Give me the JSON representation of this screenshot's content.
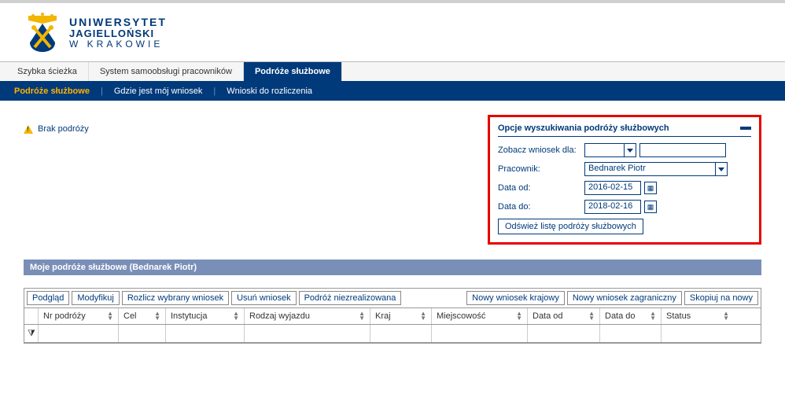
{
  "org": {
    "line1": "UNIWERSYTET",
    "line2": "JAGIELLOŃSKI",
    "line3": "W KRAKOWIE"
  },
  "nav1": {
    "tabs": [
      {
        "label": "Szybka ścieżka",
        "active": false
      },
      {
        "label": "System samoobsługi pracowników",
        "active": false
      },
      {
        "label": "Podróże służbowe",
        "active": true
      }
    ]
  },
  "nav2": {
    "items": [
      {
        "label": "Podróże służbowe",
        "active": true
      },
      {
        "label": "Gdzie jest mój wniosek",
        "active": false
      },
      {
        "label": "Wnioski do rozliczenia",
        "active": false
      }
    ]
  },
  "warning": "Brak podróży",
  "search": {
    "title": "Opcje wyszukiwania podróży służbowych",
    "zobacz_label": "Zobacz wniosek dla:",
    "zobacz_value": "",
    "pracownik_label": "Pracownik:",
    "pracownik_value": "Bednarek Piotr",
    "data_od_label": "Data od:",
    "data_od_value": "2016-02-15",
    "data_do_label": "Data do:",
    "data_do_value": "2018-02-16",
    "refresh": "Odśwież listę podróży służbowych"
  },
  "section_title": "Moje podróże służbowe (Bednarek Piotr)",
  "toolbar": {
    "left": [
      "Podgląd",
      "Modyfikuj",
      "Rozlicz wybrany wniosek",
      "Usuń wniosek",
      "Podróż niezrealizowana"
    ],
    "right": [
      "Nowy wniosek krajowy",
      "Nowy wniosek zagraniczny",
      "Skopiuj na nowy"
    ]
  },
  "grid": {
    "columns": [
      "",
      "Nr podróży",
      "Cel",
      "Instytucja",
      "Rodzaj wyjazdu",
      "Kraj",
      "Miejscowość",
      "Data od",
      "Data do",
      "Status"
    ]
  }
}
